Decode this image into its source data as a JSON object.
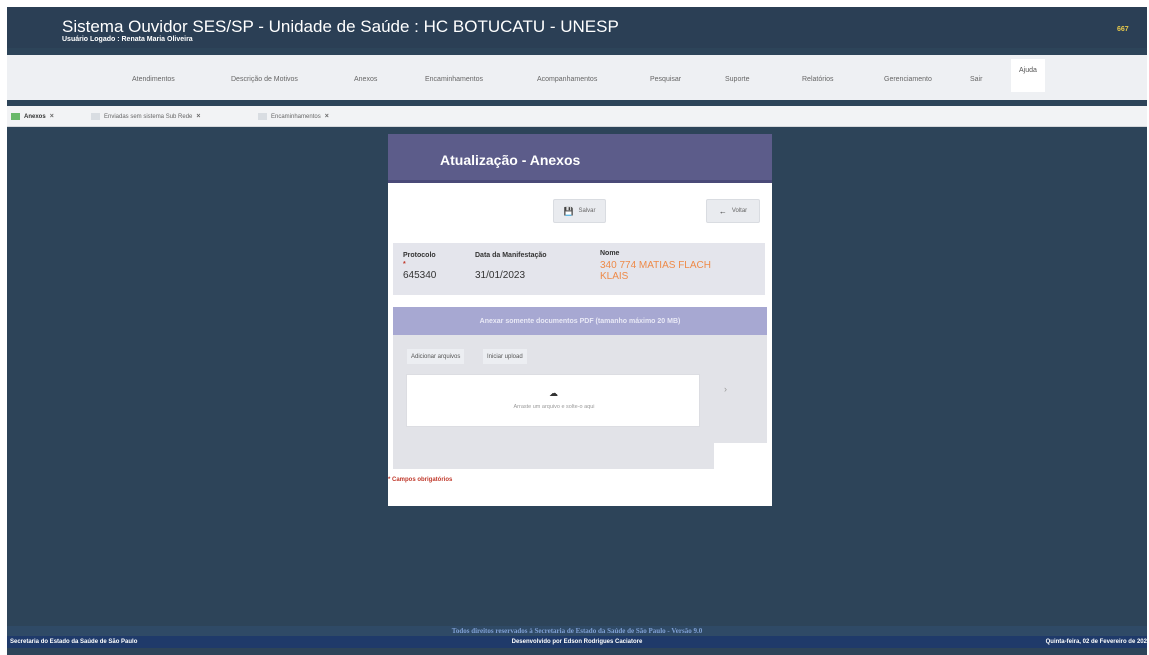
{
  "header": {
    "title": "Sistema Ouvidor SES/SP - Unidade de Saúde : HC BOTUCATU - UNESP",
    "user": "Usuário Logado : Renata Maria Oliveira",
    "badge": "667"
  },
  "menu": {
    "items": [
      "Atendimentos",
      "Descrição de Motivos",
      "Anexos",
      "Encaminhamentos",
      "Acompanhamentos",
      "Pesquisar",
      "Suporte",
      "Relatórios",
      "Gerenciamento",
      "Sair",
      "Ajuda"
    ]
  },
  "tabs": [
    {
      "label": "Anexos",
      "active": true
    },
    {
      "label": "Enviadas sem sistema Sub Rede",
      "active": false
    },
    {
      "label": "Encaminhamentos",
      "active": false
    }
  ],
  "panel": {
    "title": "Atualização - Anexos",
    "save_label": "Salvar",
    "back_label": "Voltar",
    "protocol_label": "Protocolo",
    "protocol_required": "*",
    "protocol_value": "645340",
    "date_label": "Data da Manifestação",
    "date_value": "31/01/2023",
    "name_label": "Nome",
    "name_value": "340 774 MATIAS FLACH KLAIS",
    "upload_banner": "Anexar somente documentos PDF (tamanho máximo 20 MB)",
    "add_files": "Adicionar arquivos",
    "start_upload": "Iniciar upload",
    "dropzone_text": "Arraste um arquivo e solte-o aqui",
    "required_note": "* Campos obrigatórios"
  },
  "footer": {
    "rights": "Todos direitos reservados à Secretaria de Estado da Saúde de São Paulo - Versão 9.0",
    "left": "Secretaria do Estado da Saúde de São Paulo",
    "center": "Desenvolvido por Edson Rodrigues Caciatore",
    "right": "Quinta-feira, 02 de Fevereiro de 202"
  },
  "colors": {
    "background": "#2d4459",
    "panel_header": "#5c5c8a",
    "upload_banner": "#a7a8d2",
    "name_value": "#ee8a48",
    "required": "#c0392b",
    "active_tab": "#69b86a"
  },
  "icons": [
    "save-icon",
    "arrow-left-icon",
    "cloud-upload-icon",
    "chevron-right-icon",
    "close-icon"
  ]
}
